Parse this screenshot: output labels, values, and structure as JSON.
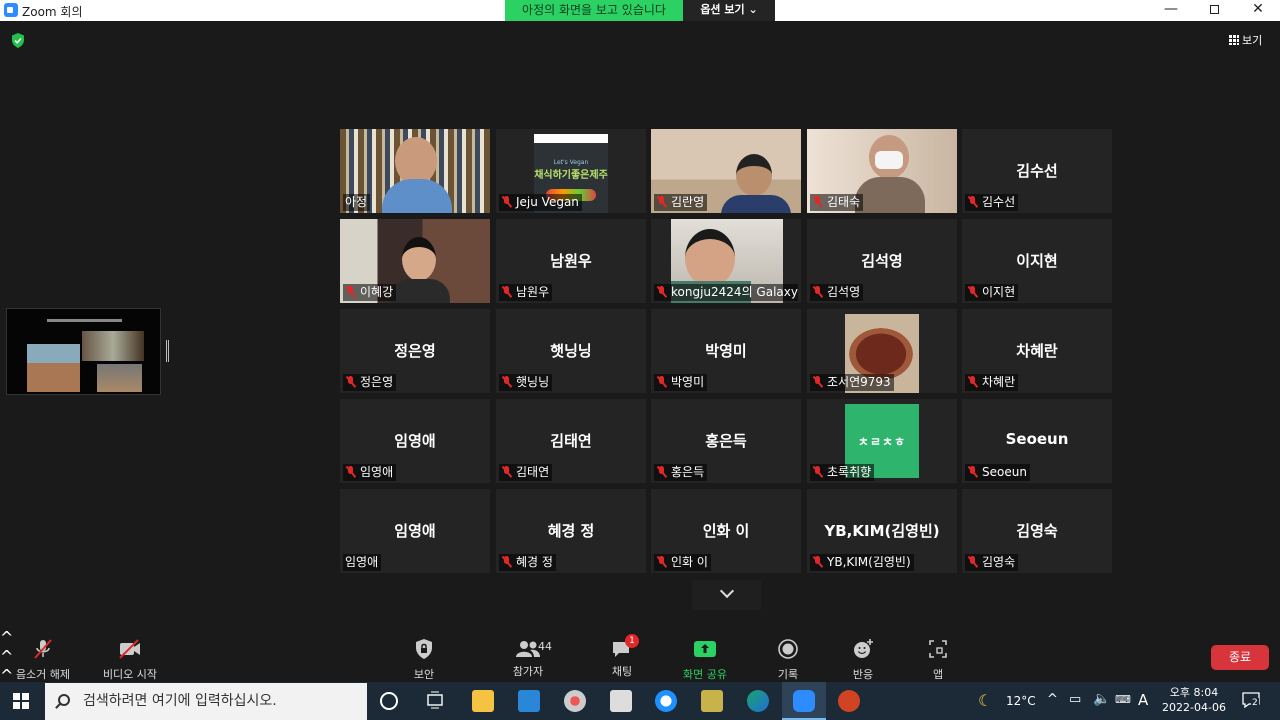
{
  "window": {
    "title": "Zoom 회의"
  },
  "banner": {
    "sharing_text": "아정의 화면을 보고 있습니다",
    "view_options": "옵션 보기 ⌄"
  },
  "top_right": {
    "view_label": "보기"
  },
  "participants": [
    {
      "name": "아정",
      "center": "",
      "muted": false,
      "video": "person-bookshelf",
      "active": true
    },
    {
      "name": "Jeju Vegan",
      "center": "",
      "muted": true,
      "video": "jeju-vegan-logo"
    },
    {
      "name": "김란영",
      "center": "",
      "muted": true,
      "video": "person-glasses"
    },
    {
      "name": "김태숙",
      "center": "",
      "muted": true,
      "video": "person-mask"
    },
    {
      "name": "김수선",
      "center": "김수선",
      "muted": true
    },
    {
      "name": "이혜강",
      "center": "",
      "muted": true,
      "video": "person-girl"
    },
    {
      "name": "남원우",
      "center": "남원우",
      "muted": true
    },
    {
      "name": "kongju2424의 Galaxy ...",
      "center": "",
      "muted": true,
      "video": "person-face"
    },
    {
      "name": "김석영",
      "center": "김석영",
      "muted": true
    },
    {
      "name": "이지현",
      "center": "이지현",
      "muted": true
    },
    {
      "name": "정은영",
      "center": "정은영",
      "muted": true
    },
    {
      "name": "햇닝닝",
      "center": "햇닝닝",
      "muted": true
    },
    {
      "name": "박영미",
      "center": "박영미",
      "muted": true
    },
    {
      "name": "조서연9793",
      "center": "",
      "muted": true,
      "video": "food-bowl"
    },
    {
      "name": "차혜란",
      "center": "차혜란",
      "muted": true
    },
    {
      "name": "임영애",
      "center": "임영애",
      "muted": true
    },
    {
      "name": "김태연",
      "center": "김태연",
      "muted": true
    },
    {
      "name": "홍은득",
      "center": "홍은득",
      "muted": true
    },
    {
      "name": "초록취향",
      "center": "",
      "muted": true,
      "video": "green-logo",
      "logo_text": "ㅊㄹㅊㅎ"
    },
    {
      "name": "Seoeun",
      "center": "Seoeun",
      "muted": true
    },
    {
      "name": "임영애",
      "center": "임영애",
      "muted": false
    },
    {
      "name": "혜경 정",
      "center": "혜경 정",
      "muted": true
    },
    {
      "name": "인화 이",
      "center": "인화 이",
      "muted": true
    },
    {
      "name": "YB,KIM(김영빈)",
      "center": "YB,KIM(김영빈)",
      "muted": true
    },
    {
      "name": "김영숙",
      "center": "김영숙",
      "muted": true
    }
  ],
  "logos": {
    "jeju_vegan_top": "Let's Vegan",
    "jeju_vegan_main": "채식하기좋은제주"
  },
  "toolbar": {
    "unmute": "음소거 해제",
    "start_video": "비디오 시작",
    "security": "보안",
    "participants": "참가자",
    "participant_count": "44",
    "chat": "채팅",
    "chat_badge": "1",
    "share_screen": "화면 공유",
    "record": "기록",
    "reactions": "반응",
    "apps": "앱",
    "end": "종료"
  },
  "taskbar": {
    "search_placeholder": "검색하려면 여기에 입력하십시오.",
    "temperature": "12°C",
    "ime": "A",
    "time": "오후 8:04",
    "date": "2022-04-06",
    "notification_count": "2"
  },
  "colors": {
    "accent_green": "#2bd163",
    "active_border": "#c4e03a",
    "end_red": "#d8343c",
    "muted_red": "#e02828"
  }
}
